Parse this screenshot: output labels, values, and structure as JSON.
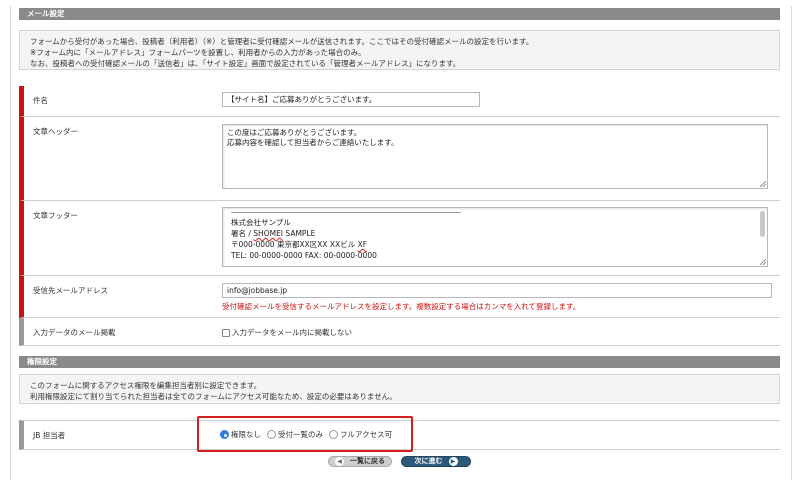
{
  "mail_section": {
    "header": "メール設定",
    "notice": [
      "フォームから受付があった場合、投稿者（利用者）（※）と管理者に受付確認メールが送信されます。ここではその受付確認メールの設定を行います。",
      "※フォーム内に「メールアドレス」フォームパーツを設置し、利用者からの入力があった場合のみ。",
      "なお、投稿者への受付確認メールの「送信者」は、「サイト設定」画面で設定されている「管理者メールアドレス」になります。"
    ],
    "subject": {
      "label": "件名",
      "value": "【サイト名】ご応募ありがとうございます。"
    },
    "header_text": {
      "label": "文章ヘッダー",
      "lines": [
        "この度はご応募ありがとうございます。",
        "応募内容を確認して担当者からご連絡いたします。"
      ]
    },
    "footer_text": {
      "label": "文章フッター",
      "company": "株式会社サンプル",
      "sign_prefix": "署名 / ",
      "sign_name": "SHOMEI",
      "sign_suffix": " SAMPLE",
      "address_prefix": "〒000-0000 東京都XX区XX XXビル ",
      "address_suffix": "XF",
      "tel": "TEL: 00-0000-0000 FAX: 00-0000-0000"
    },
    "recipient": {
      "label": "受信先メールアドレス",
      "value": "info@jobbase.jp",
      "note": "受付確認メールを受信するメールアドレスを設定します。複数設定する場合はカンマを入れて登録します。"
    },
    "include_input": {
      "label": "入力データのメール掲載",
      "checkbox_label": "入力データをメール内に掲載しない"
    }
  },
  "permission_section": {
    "header": "権限設定",
    "notice": [
      "このフォームに関するアクセス権限を編集担当者別に設定できます。",
      "利用権限設定にて割り当てられた担当者は全てのフォームにアクセス可能なため、設定の必要はありません。"
    ],
    "assignee": {
      "label": "JB 担当者",
      "options": [
        "権限なし",
        "受付一覧のみ",
        "フルアクセス可"
      ],
      "selected": "権限なし"
    }
  },
  "buttons": {
    "back": "一覧に戻る",
    "next": "次に進む"
  },
  "colors": {
    "required_bar": "#cc1111",
    "accent_red": "#d41e1e",
    "next_button": "#2d5a78",
    "radio_selected": "#2a7fd9"
  },
  "icons": {
    "back": "chevron-left-icon",
    "next": "chevron-right-icon"
  }
}
